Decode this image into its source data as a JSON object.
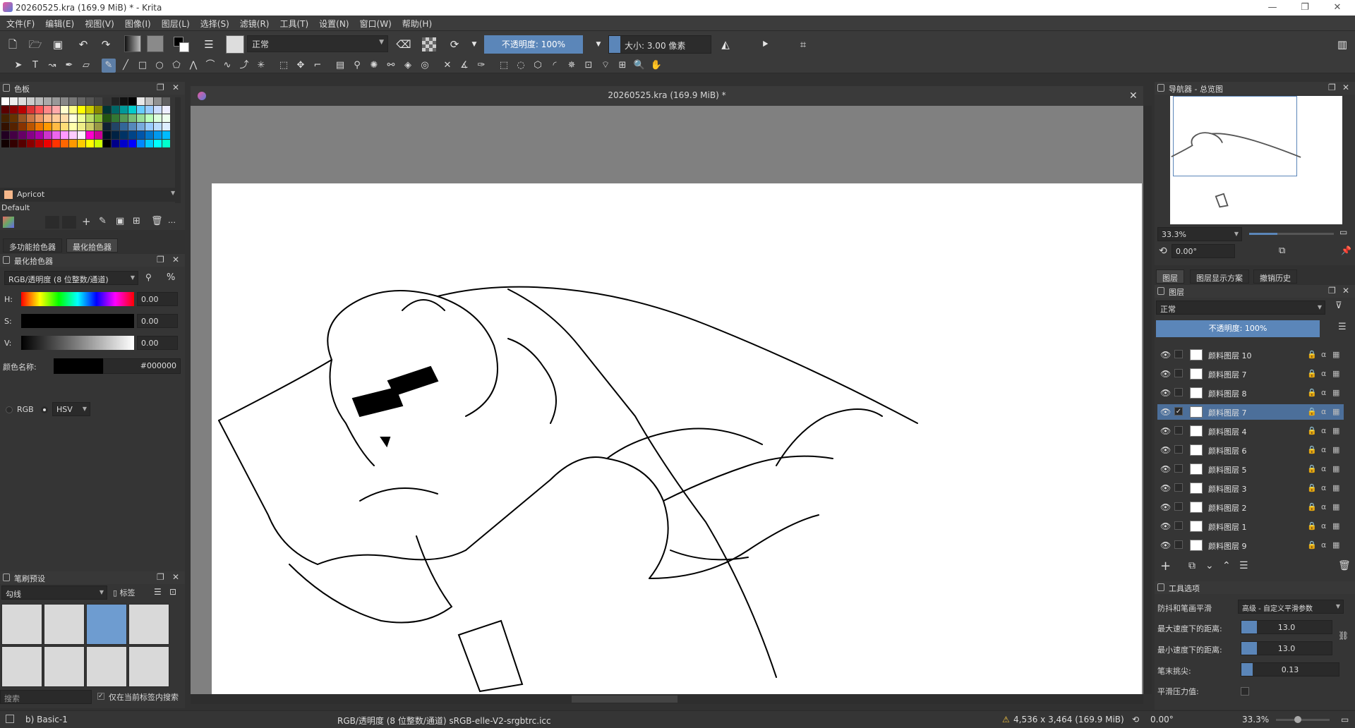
{
  "window": {
    "title": "20260525.kra (169.9 MiB) * - Krita"
  },
  "menu": [
    "文件(F)",
    "编辑(E)",
    "视图(V)",
    "图像(I)",
    "图层(L)",
    "选择(S)",
    "滤镜(R)",
    "工具(T)",
    "设置(N)",
    "窗口(W)",
    "帮助(H)"
  ],
  "toolbar": {
    "blend_mode": "正常",
    "opacity": "不透明度: 100%",
    "size": "大小: 3.00 像素"
  },
  "palette": {
    "title": "色板",
    "color_name": "Apricot",
    "preset": "Default"
  },
  "picker_tabs": [
    "多功能拾色器",
    "最化拾色器"
  ],
  "picker": {
    "title": "最化拾色器",
    "model": "RGB/透明度 (8 位整数/通道)",
    "percent": "%",
    "rows": [
      {
        "label": "H:",
        "value": "0.00"
      },
      {
        "label": "S:",
        "value": "0.00"
      },
      {
        "label": "V:",
        "value": "0.00"
      }
    ],
    "color_name_label": "颜色名称:",
    "hex": "#000000",
    "radio_rgb": "RGB",
    "radio_hsv": "HSV"
  },
  "brushes": {
    "title": "笔刷预设",
    "tag": "勾线",
    "tag_label": "标签",
    "search_placeholder": "搜索",
    "only_tag": "仅在当前标签内搜索"
  },
  "document": {
    "tab_title": "20260525.kra (169.9 MiB) *"
  },
  "navigator": {
    "title": "导航器 - 总览图",
    "zoom": "33.3%",
    "rotation": "0.00°"
  },
  "right_tabs": [
    "图层",
    "图层显示方案",
    "撤销历史"
  ],
  "layers": {
    "title": "图层",
    "blend_mode": "正常",
    "opacity": "不透明度: 100%",
    "items": [
      {
        "name": "颜料图层 10",
        "selected": false,
        "checked": false
      },
      {
        "name": "颜料图层 7",
        "selected": false,
        "checked": false
      },
      {
        "name": "颜料图层 8",
        "selected": false,
        "checked": false
      },
      {
        "name": "颜料图层 7",
        "selected": true,
        "checked": true
      },
      {
        "name": "颜料图层 4",
        "selected": false,
        "checked": false
      },
      {
        "name": "颜料图层 6",
        "selected": false,
        "checked": false
      },
      {
        "name": "颜料图层 5",
        "selected": false,
        "checked": false
      },
      {
        "name": "颜料图层 3",
        "selected": false,
        "checked": false
      },
      {
        "name": "颜料图层 2",
        "selected": false,
        "checked": false
      },
      {
        "name": "颜料图层 1",
        "selected": false,
        "checked": false
      },
      {
        "name": "颜料图层 9",
        "selected": false,
        "checked": false
      }
    ]
  },
  "tool_options": {
    "title": "工具选项",
    "smoothing_label": "防抖和笔画平滑",
    "smoothing_value": "高级 - 自定义平滑参数",
    "rows": [
      {
        "label": "最大速度下的距离:",
        "value": "13.0"
      },
      {
        "label": "最小速度下的距离:",
        "value": "13.0"
      },
      {
        "label": "笔末挑尖:",
        "value": "0.13"
      }
    ],
    "pressure_label": "平滑压力值:"
  },
  "status": {
    "brush": "b) Basic-1",
    "color_space": "RGB/透明度 (8 位整数/通道)  sRGB-elle-V2-srgbtrc.icc",
    "dimensions": "4,536 x 3,464 (169.9 MiB)",
    "rotation": "0.00°",
    "zoom": "33.3%"
  },
  "colors": {
    "accent": "#5b86b9",
    "selected_layer": "#4c6f9a",
    "canvas_bg": "#808080"
  }
}
